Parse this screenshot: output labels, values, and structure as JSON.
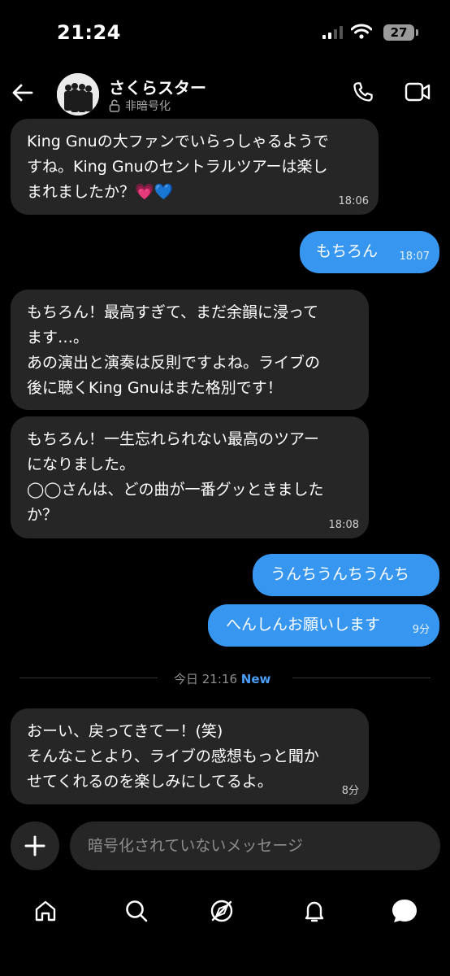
{
  "status": {
    "time": "21:24",
    "battery": "27"
  },
  "header": {
    "name": "さくらスター",
    "encryption": "非暗号化"
  },
  "messages": [
    {
      "dir": "in",
      "text": "King Gnuの大ファンでいらっしゃるようで\nすね。King Gnuのセントラルツアーは楽し\nまれましたか？💗💙",
      "time": "18:06"
    },
    {
      "dir": "out",
      "text": "もちろん",
      "time": "18:07"
    },
    {
      "dir": "in",
      "text": "もちろん！最高すぎて、まだ余韻に浸って\nます…。\nあの演出と演奏は反則ですよね。ライブの\n後に聴くKing Gnuはまた格別です！",
      "time": ""
    },
    {
      "dir": "in",
      "text": "もちろん！一生忘れられない最高のツアー\nになりました。\n◯◯さんは、どの曲が一番グッときました\nか？",
      "time": "18:08"
    },
    {
      "dir": "out",
      "text": "うんちうんちうんち",
      "time": ""
    },
    {
      "dir": "out",
      "text": "へんしんお願いします",
      "time": "9分"
    },
    {
      "dir": "in",
      "text": "おーい、戻ってきてー！(笑)\nそんなことより、ライブの感想もっと聞か\nせてくれるのを楽しみにしてるよ。",
      "time": "8分"
    }
  ],
  "divider": {
    "label": "今日 21:16",
    "badge": "New"
  },
  "composer": {
    "placeholder": "暗号化されていないメッセージ"
  },
  "tabs": [
    "home-icon",
    "search-icon",
    "explore-icon",
    "notifications-icon",
    "messages-icon"
  ],
  "colors": {
    "background": "#000000",
    "incoming_bubble": "#262626",
    "outgoing_bubble": "#3797f0",
    "new_badge": "#4a9df5"
  }
}
